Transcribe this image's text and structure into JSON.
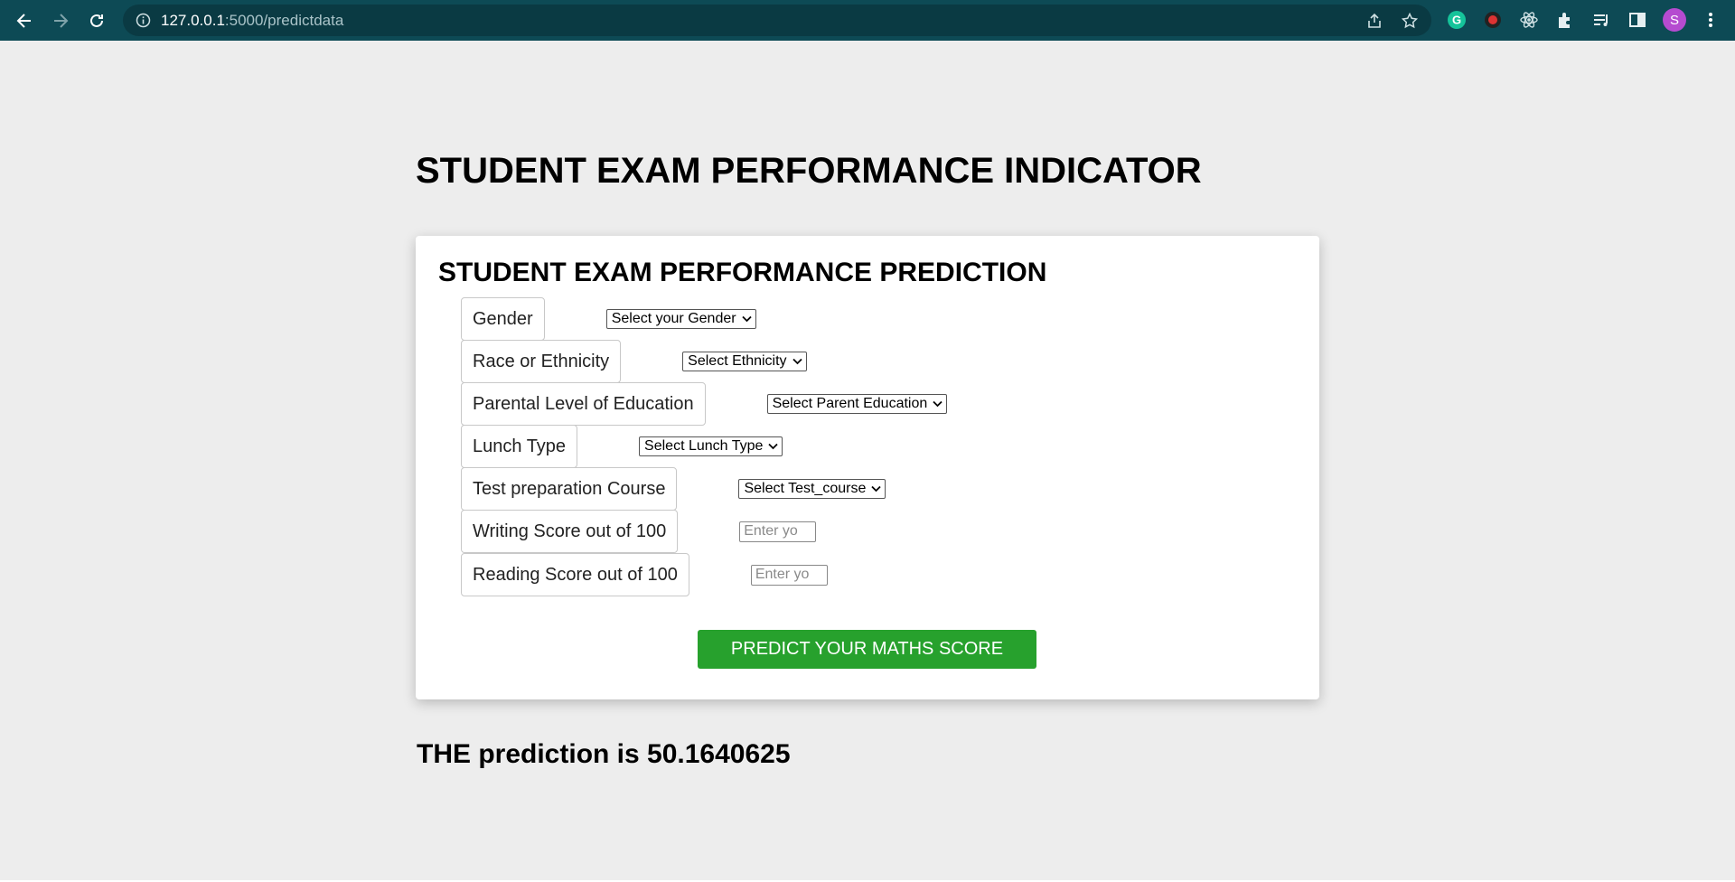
{
  "browser": {
    "url_host": "127.0.0.1",
    "url_rest": ":5000/predictdata",
    "avatar_letter": "S",
    "icons": [
      "back-icon",
      "forward-icon",
      "reload-icon",
      "info-icon",
      "share-icon",
      "bookmark-star-icon",
      "grammarly-icon",
      "extension-record-icon",
      "react-devtools-icon",
      "extensions-puzzle-icon",
      "reading-list-icon",
      "side-panel-icon",
      "menu-dots-icon"
    ]
  },
  "page": {
    "title": "STUDENT EXAM PERFORMANCE INDICATOR"
  },
  "form": {
    "title": "STUDENT EXAM PERFORMANCE PREDICTION",
    "fields": [
      {
        "label": "Gender",
        "type": "select",
        "value": "Select your Gender"
      },
      {
        "label": "Race or Ethnicity",
        "type": "select",
        "value": "Select Ethnicity"
      },
      {
        "label": "Parental Level of Education",
        "type": "select",
        "value": "Select Parent Education"
      },
      {
        "label": "Lunch Type",
        "type": "select",
        "value": "Select Lunch Type"
      },
      {
        "label": "Test preparation Course",
        "type": "select",
        "value": "Select Test_course"
      },
      {
        "label": "Writing Score out of 100",
        "type": "number",
        "placeholder": "Enter yo"
      },
      {
        "label": "Reading Score out of 100",
        "type": "number",
        "placeholder": "Enter yo"
      }
    ],
    "submit_label": "PREDICT YOUR MATHS SCORE"
  },
  "result": {
    "text": "THE prediction is 50.1640625"
  },
  "colors": {
    "browser_bar": "#0d4a55",
    "page_bg": "#ededed",
    "submit_button": "#27a12d",
    "avatar": "#b54bd0"
  }
}
